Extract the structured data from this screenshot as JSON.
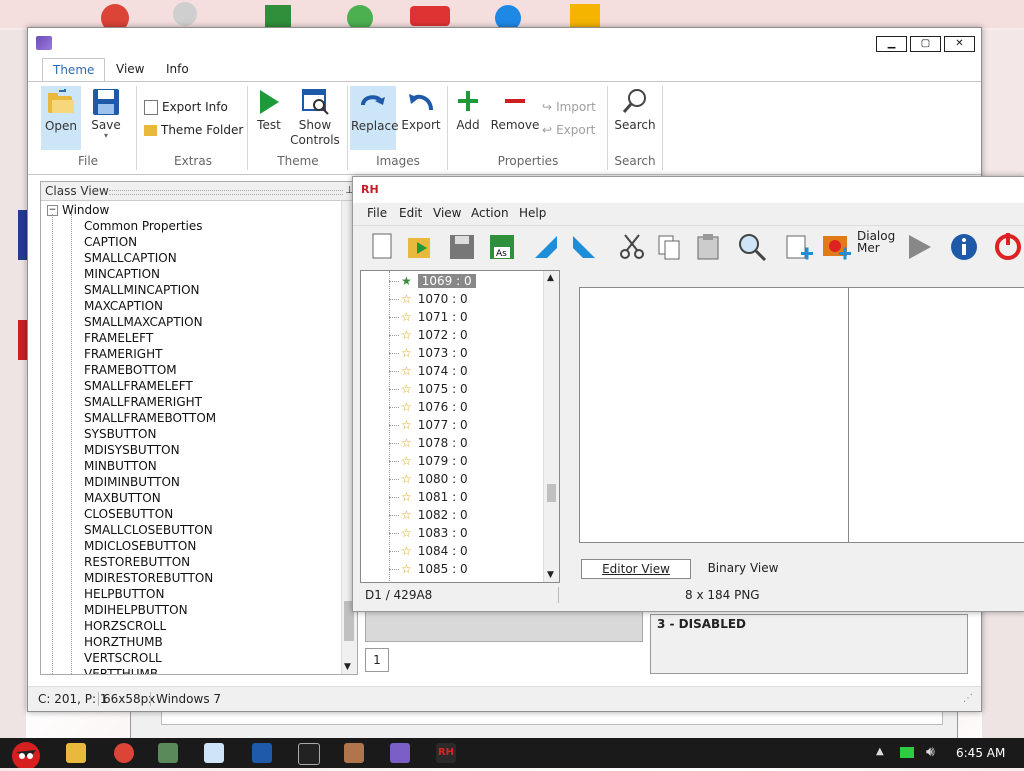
{
  "ribbon": {
    "tabs": [
      {
        "label": "Theme"
      },
      {
        "label": "View"
      },
      {
        "label": "Info"
      }
    ],
    "file": {
      "open": "Open",
      "save": "Save",
      "group": "File"
    },
    "extras": {
      "export_info": "Export Info",
      "theme_folder": "Theme Folder",
      "group": "Extras"
    },
    "theme": {
      "test": "Test",
      "show_controls_1": "Show",
      "show_controls_2": "Controls",
      "group": "Theme"
    },
    "images": {
      "replace": "Replace",
      "export": "Export",
      "group": "Images"
    },
    "properties": {
      "add": "Add",
      "remove": "Remove",
      "import": "Import",
      "export": "Export",
      "group": "Properties"
    },
    "search": {
      "search": "Search",
      "group": "Search"
    }
  },
  "class_view": {
    "title": "Class View",
    "root": "Window",
    "items": [
      "Common Properties",
      "CAPTION",
      "SMALLCAPTION",
      "MINCAPTION",
      "SMALLMINCAPTION",
      "MAXCAPTION",
      "SMALLMAXCAPTION",
      "FRAMELEFT",
      "FRAMERIGHT",
      "FRAMEBOTTOM",
      "SMALLFRAMELEFT",
      "SMALLFRAMERIGHT",
      "SMALLFRAMEBOTTOM",
      "SYSBUTTON",
      "MDISYSBUTTON",
      "MINBUTTON",
      "MDIMINBUTTON",
      "MAXBUTTON",
      "CLOSEBUTTON",
      "SMALLCLOSEBUTTON",
      "MDICLOSEBUTTON",
      "RESTOREBUTTON",
      "MDIRESTOREBUTTON",
      "HELPBUTTON",
      "MDIHELPBUTTON",
      "HORZSCROLL",
      "HORZTHUMB",
      "VERTSCROLL",
      "VERTTHUMB"
    ]
  },
  "status": {
    "position": "C: 201, P: 1",
    "size": "66x58px",
    "os": "Windows 7"
  },
  "rh": {
    "title_icon": "RH",
    "menu": [
      "File",
      "Edit",
      "View",
      "Action",
      "Help"
    ],
    "tree_items": [
      "1069 : 0",
      "1070 : 0",
      "1071 : 0",
      "1072 : 0",
      "1073 : 0",
      "1074 : 0",
      "1075 : 0",
      "1076 : 0",
      "1077 : 0",
      "1078 : 0",
      "1079 : 0",
      "1080 : 0",
      "1081 : 0",
      "1082 : 0",
      "1083 : 0",
      "1084 : 0",
      "1085 : 0"
    ],
    "tabs": {
      "editor": "Editor View",
      "binary": "Binary View"
    },
    "status_left": "D1 / 429A8",
    "status_right": "8 x 184  PNG",
    "dialog_label_1": "Dialog",
    "dialog_label_2": "Mer"
  },
  "lower_panel": {
    "page": "1",
    "state": "3 - DISABLED"
  },
  "taskbar": {
    "time": "6:45 AM"
  }
}
